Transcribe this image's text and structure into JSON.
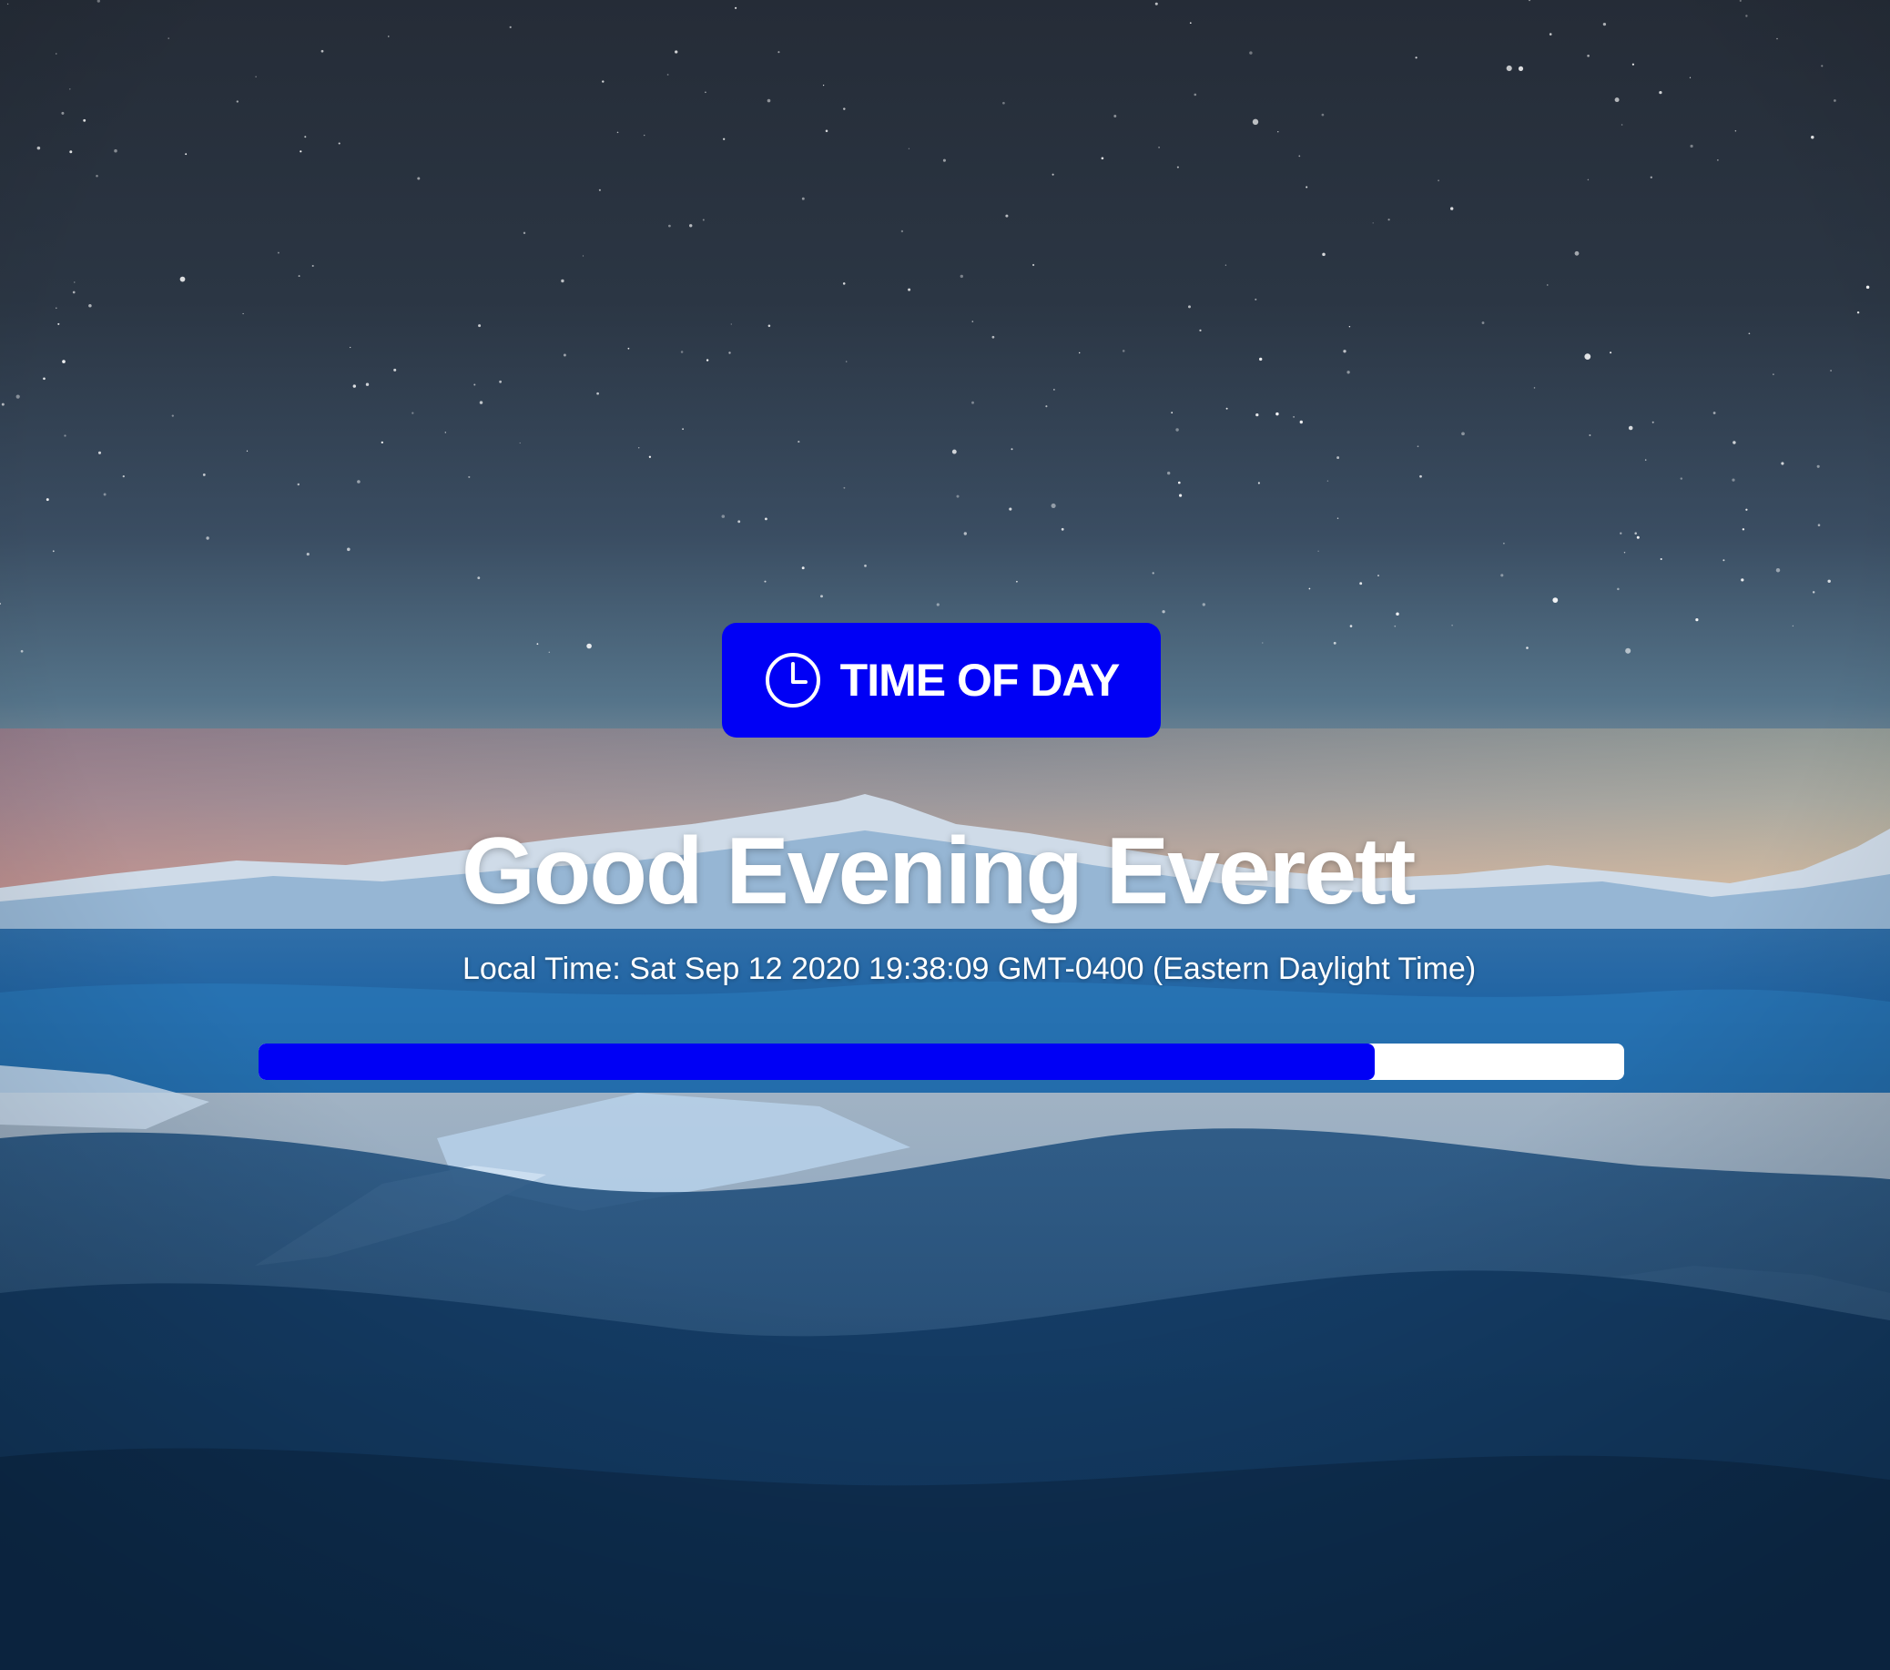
{
  "button": {
    "label": "TIME OF DAY",
    "icon": "clock-icon",
    "color": "#0000f5"
  },
  "greeting": "Good Evening Everett",
  "local_time": "Local Time: Sat Sep 12 2020 19:38:09 GMT-0400 (Eastern Daylight Time)",
  "progress": {
    "value": 0.8175,
    "fill_color": "#0000f5",
    "track_color": "#ffffff"
  },
  "background": {
    "scene": "night sky over snowy mountains"
  }
}
